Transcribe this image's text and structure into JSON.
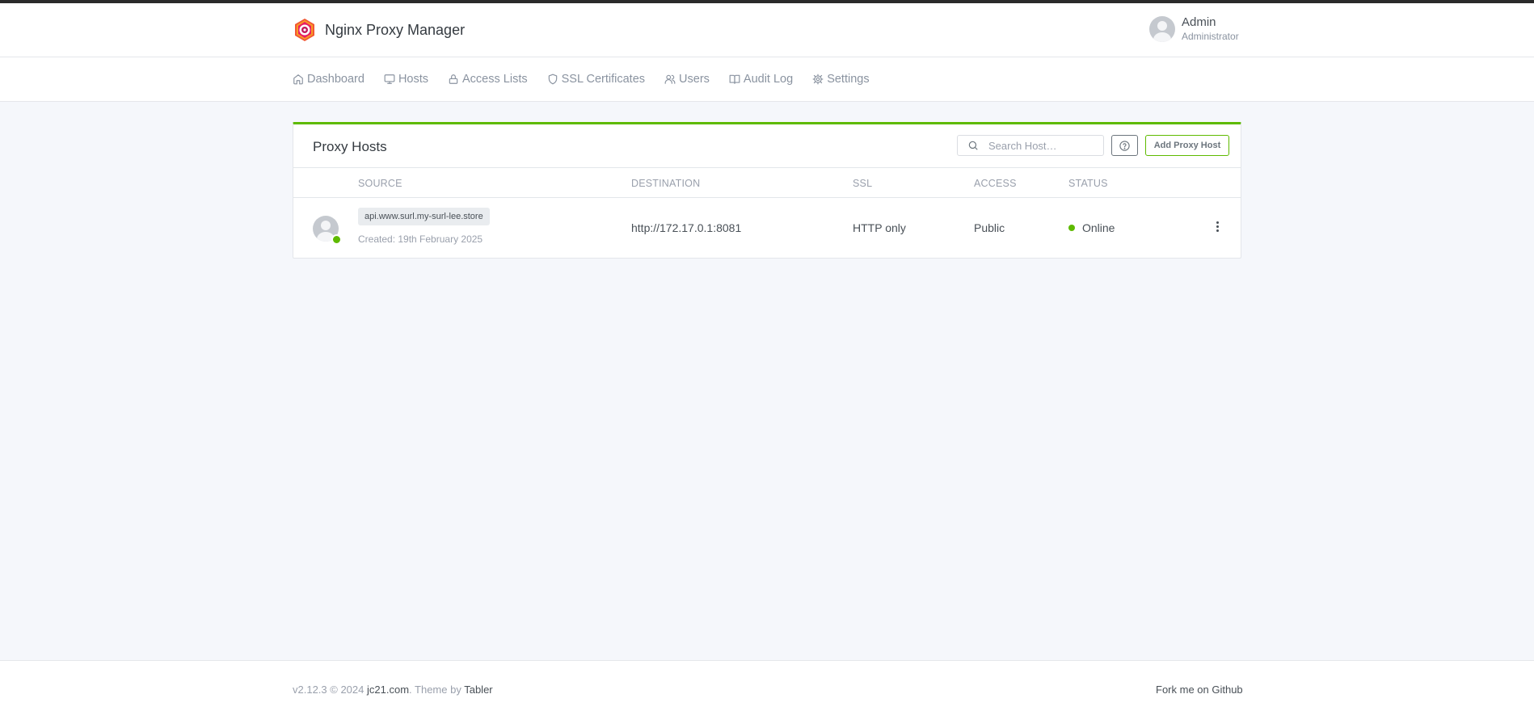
{
  "app": {
    "title": "Nginx Proxy Manager",
    "logo_icon": "nginx-proxy-manager-logo"
  },
  "user": {
    "name": "Admin",
    "role": "Administrator",
    "avatar_icon": "user-avatar-icon"
  },
  "nav": {
    "items": [
      {
        "label": "Dashboard",
        "icon": "home-icon"
      },
      {
        "label": "Hosts",
        "icon": "monitor-icon"
      },
      {
        "label": "Access Lists",
        "icon": "lock-icon"
      },
      {
        "label": "SSL Certificates",
        "icon": "shield-icon"
      },
      {
        "label": "Users",
        "icon": "users-icon"
      },
      {
        "label": "Audit Log",
        "icon": "book-icon"
      },
      {
        "label": "Settings",
        "icon": "gear-icon"
      }
    ]
  },
  "card": {
    "title": "Proxy Hosts",
    "search_placeholder": "Search Host…",
    "add_button": "Add Proxy Host",
    "accent_color": "#5eba00"
  },
  "table": {
    "columns": [
      "SOURCE",
      "DESTINATION",
      "SSL",
      "ACCESS",
      "STATUS"
    ],
    "rows": [
      {
        "domain": "api.www.surl.my-surl-lee.store",
        "created": "Created: 19th February 2025",
        "destination": "http://172.17.0.1:8081",
        "ssl": "HTTP only",
        "access": "Public",
        "status": "Online",
        "status_color": "#5eba00"
      }
    ]
  },
  "footer": {
    "version": "v2.12.3 © 2024",
    "author_link": "jc21.com",
    "theme_text": ". Theme by",
    "theme_link": "Tabler",
    "github": "Fork me on Github"
  }
}
